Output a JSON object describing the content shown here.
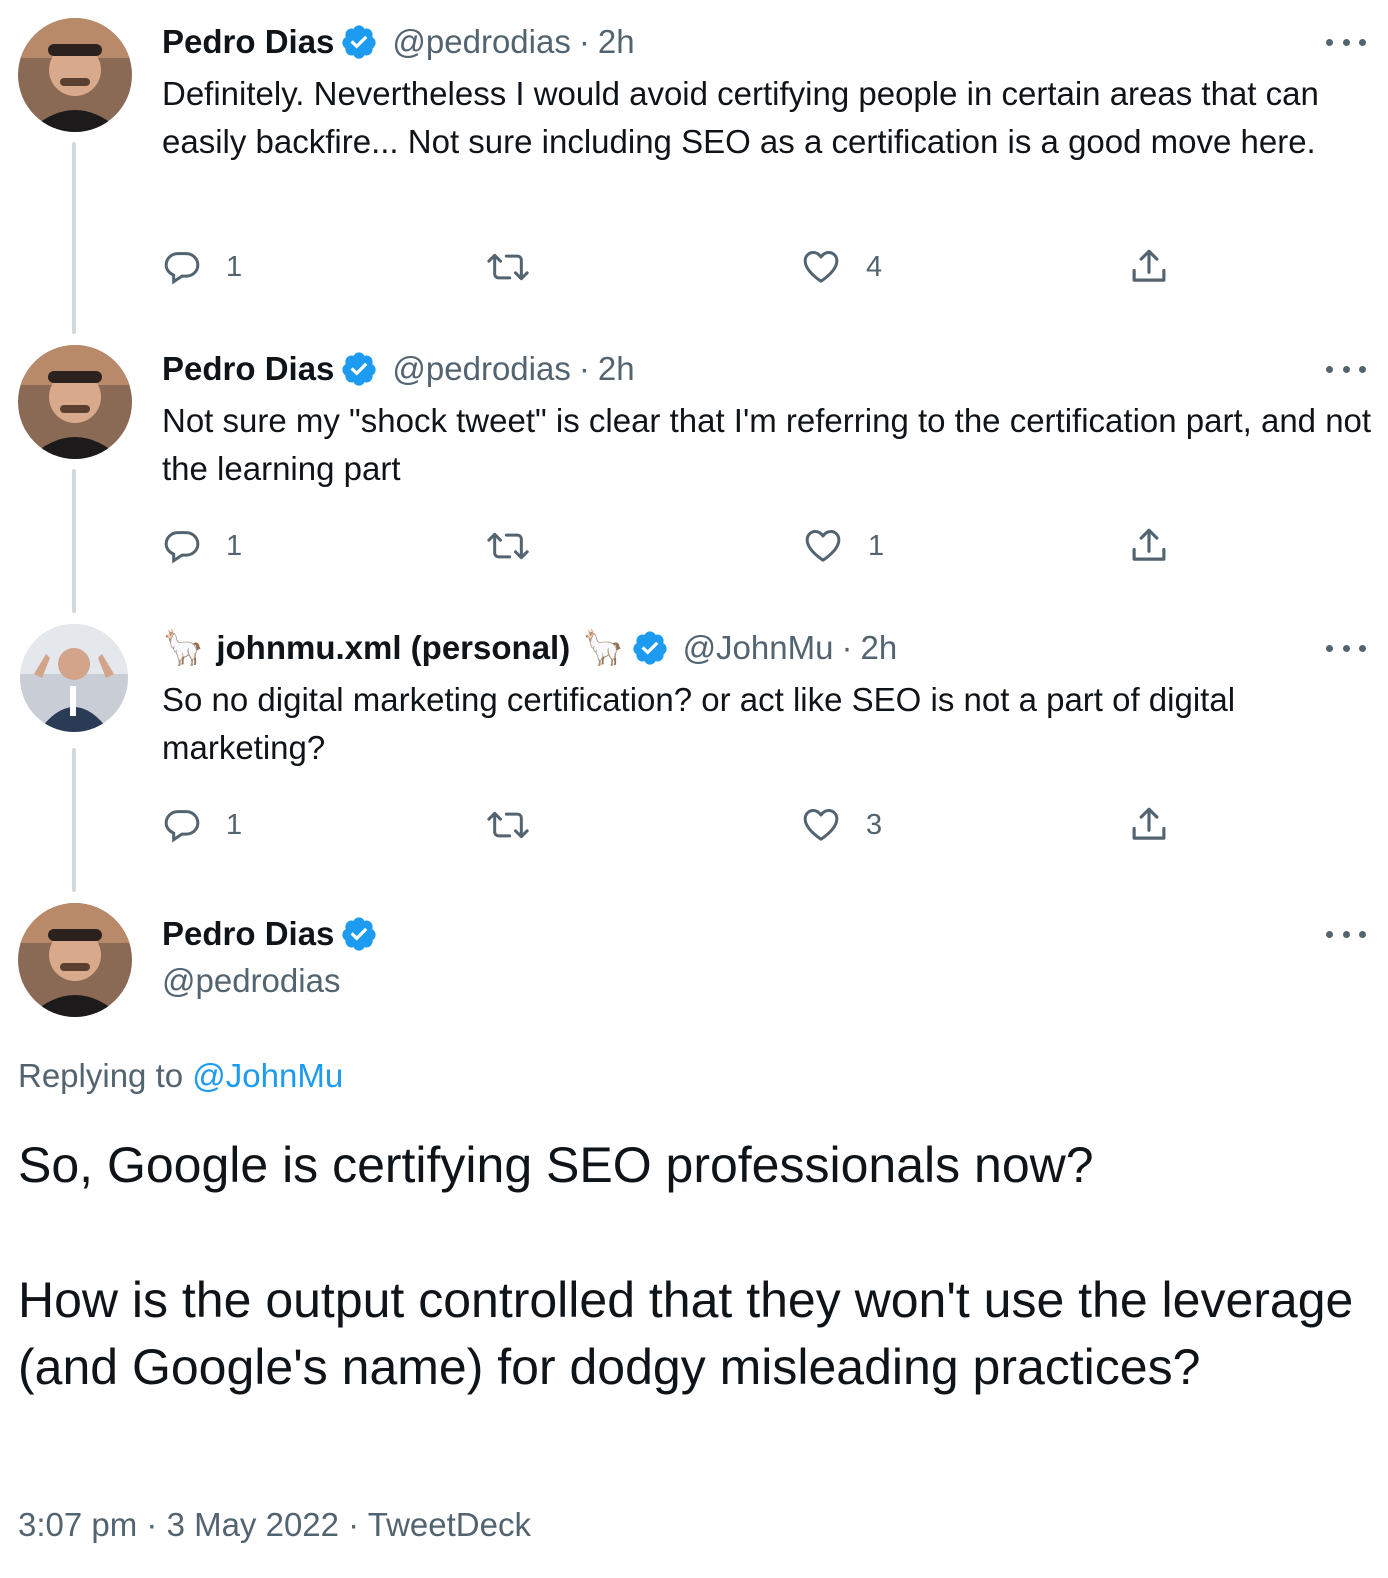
{
  "tweets": [
    {
      "name": "Pedro Dias",
      "handle": "@pedrodias",
      "dot": "·",
      "time": "2h",
      "text": "Definitely. Nevertheless I would avoid certifying people in certain areas that can easily backfire... Not sure including SEO as a certification is a good move here.",
      "replies": "1",
      "likes": "4"
    },
    {
      "name": "Pedro Dias",
      "handle": "@pedrodias",
      "dot": "·",
      "time": "2h",
      "text": "Not sure my \"shock tweet\" is clear that I'm referring to the certification part, and not the learning part",
      "replies": "1",
      "likes": "1"
    },
    {
      "name": "johnmu.xml (personal)",
      "name_emoji": "🦙",
      "handle": "@JohnMu",
      "dot": "·",
      "time": "2h",
      "text": "So no digital marketing certification? or act like SEO is not a part of digital marketing?",
      "replies": "1",
      "likes": "3"
    }
  ],
  "main_tweet": {
    "name": "Pedro Dias",
    "handle": "@pedrodias",
    "replying_prefix": "Replying to ",
    "replying_to": "@JohnMu",
    "paragraph_1": "So, Google is certifying SEO professionals now?",
    "paragraph_2": "How is the output controlled that they won't use the leverage (and Google's name) for dodgy misleading practices?",
    "timestamp": "3:07 pm · 3 May 2022 · TweetDeck"
  },
  "colors": {
    "primary_text": "#0f1419",
    "secondary_text": "#536471",
    "link": "#1d9bf0",
    "verified": "#1d9bf0",
    "thread_line": "#cfd9de"
  },
  "icons": [
    "verified-badge-icon",
    "more-options-icon",
    "reply-icon",
    "retweet-icon",
    "like-icon",
    "share-icon",
    "llama-emoji"
  ]
}
